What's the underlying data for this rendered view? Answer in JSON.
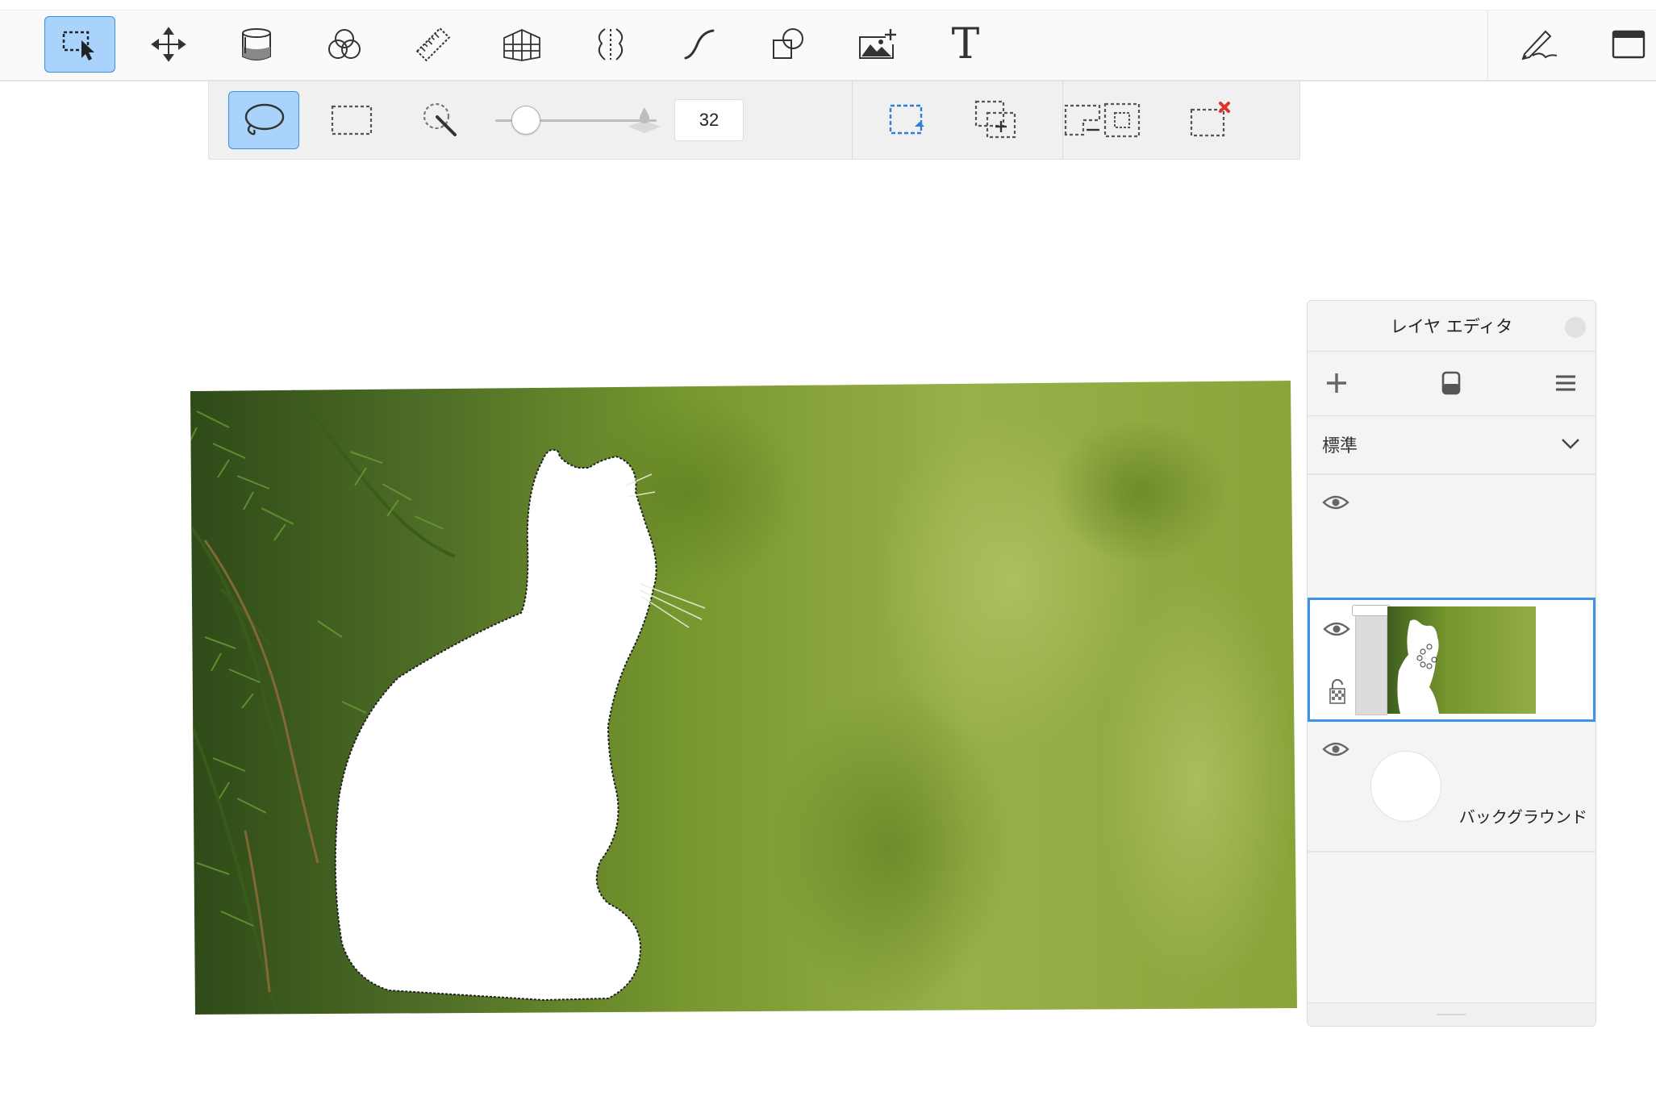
{
  "colors": {
    "accent": "#3d93e8",
    "active_button_bg": "#a9d3fb",
    "foliage": "#7a9a32"
  },
  "toolbar": {
    "tools": [
      {
        "icon": "selection-tool-icon",
        "active": true
      },
      {
        "icon": "move-tool-icon",
        "active": false
      },
      {
        "icon": "paint-bucket-icon",
        "active": false
      },
      {
        "icon": "blend-circles-icon",
        "active": false
      },
      {
        "icon": "ruler-icon",
        "active": false
      },
      {
        "icon": "perspective-grid-icon",
        "active": false
      },
      {
        "icon": "symmetry-icon",
        "active": false
      },
      {
        "icon": "curve-icon",
        "active": false
      },
      {
        "icon": "shapes-icon",
        "active": false
      },
      {
        "icon": "add-image-icon",
        "active": false
      },
      {
        "icon": "text-tool-icon",
        "active": false
      }
    ],
    "text_tool_glyph": "T",
    "right_icons": [
      "pen-settings-icon",
      "fullscreen-icon"
    ]
  },
  "selection_bar": {
    "modes": [
      {
        "icon": "lasso-select-icon",
        "active": true
      },
      {
        "icon": "rectangle-select-icon",
        "active": false
      },
      {
        "icon": "magic-wand-icon",
        "active": false
      }
    ],
    "brush_size_fraction": 0.1,
    "brush_size_value": "32",
    "feather_icon": "feather-drop-icon",
    "ops": [
      "new-selection-icon",
      "add-selection-icon",
      "subtract-selection-icon",
      "invert-selection-icon",
      "clear-selection-icon"
    ]
  },
  "layer_panel": {
    "title": "レイヤ エディタ",
    "blend_mode": "標準",
    "actions": [
      "add-layer-icon",
      "layer-eraser-icon",
      "layer-menu-icon"
    ],
    "layers": [
      {
        "name": "",
        "visible": true,
        "selected": false
      },
      {
        "name": "",
        "visible": true,
        "selected": true,
        "opacity_fraction": 0.15
      },
      {
        "name": "バックグラウンド",
        "visible": true,
        "selected": false
      }
    ]
  }
}
